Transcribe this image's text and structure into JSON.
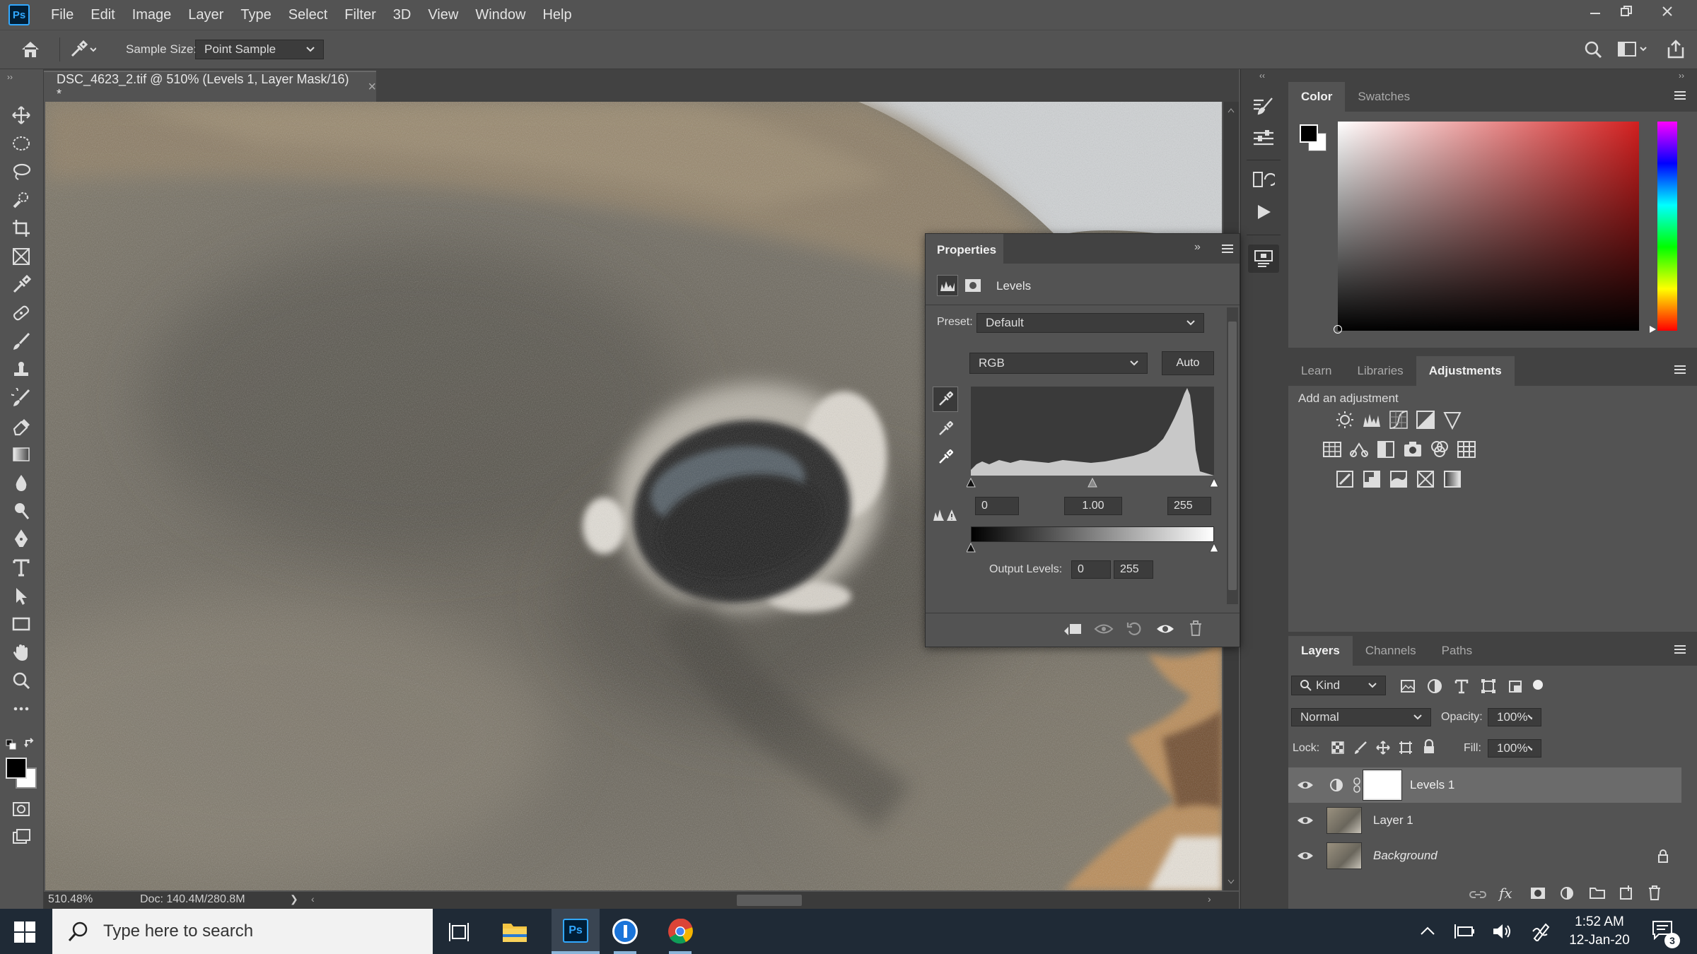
{
  "app": {
    "logo": "Ps"
  },
  "menu": [
    "File",
    "Edit",
    "Image",
    "Layer",
    "Type",
    "Select",
    "Filter",
    "3D",
    "View",
    "Window",
    "Help"
  ],
  "options": {
    "sample_size_label": "Sample Size:",
    "sample_size_value": "Point Sample"
  },
  "document": {
    "tab_title": "DSC_4623_2.tif @ 510% (Levels 1, Layer Mask/16) *",
    "close": "×"
  },
  "status": {
    "zoom": "510.48%",
    "doc": "Doc: 140.4M/280.8M",
    "arrow": "❯"
  },
  "properties": {
    "title": "Properties",
    "adjustment_name": "Levels",
    "preset_label": "Preset:",
    "preset_value": "Default",
    "channel": "RGB",
    "auto_button": "Auto",
    "input_black": "0",
    "input_gamma": "1.00",
    "input_white": "255",
    "output_label": "Output Levels:",
    "output_black": "0",
    "output_white": "255"
  },
  "color_panel": {
    "tabs": [
      "Color",
      "Swatches"
    ],
    "active": "Color"
  },
  "adjust_panel": {
    "tabs": [
      "Learn",
      "Libraries",
      "Adjustments"
    ],
    "active": "Adjustments",
    "hint": "Add an adjustment"
  },
  "layers_panel": {
    "tabs": [
      "Layers",
      "Channels",
      "Paths"
    ],
    "active": "Layers",
    "filter": "Kind",
    "blend_mode": "Normal",
    "opacity_label": "Opacity:",
    "opacity": "100%",
    "lock_label": "Lock:",
    "fill_label": "Fill:",
    "fill": "100%",
    "layers": [
      {
        "name": "Levels 1",
        "selected": true
      },
      {
        "name": "Layer 1",
        "selected": false
      },
      {
        "name": "Background",
        "selected": false
      }
    ]
  },
  "taskbar": {
    "search_placeholder": "Type here to search",
    "time": "1:52 AM",
    "date": "12-Jan-20",
    "notification_count": "3"
  },
  "colors": {
    "accent": "#31a8ff",
    "ui_bg": "#535353",
    "panel_dark": "#424242",
    "taskbar": "#1f2a36"
  }
}
